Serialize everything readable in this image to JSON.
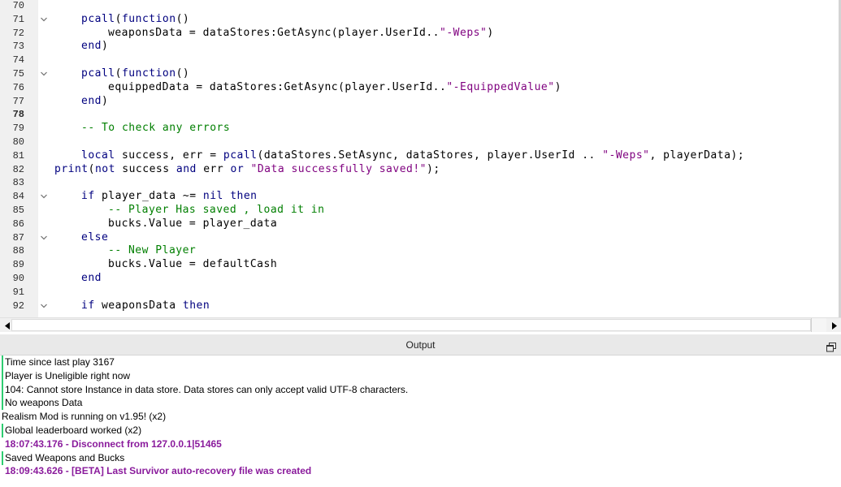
{
  "editor": {
    "lines": [
      {
        "n": "70",
        "fold": false,
        "indent": 0,
        "tokens": []
      },
      {
        "n": "71",
        "fold": true,
        "indent": 1,
        "tokens": [
          [
            "fn",
            "pcall"
          ],
          [
            "op",
            "("
          ],
          [
            "kw",
            "function"
          ],
          [
            "op",
            "()"
          ]
        ]
      },
      {
        "n": "72",
        "fold": false,
        "indent": 2,
        "tokens": [
          [
            "nm",
            "weaponsData = dataStores:GetAsync(player.UserId.."
          ],
          [
            "st",
            "\"-Weps\""
          ],
          [
            "op",
            ")"
          ]
        ]
      },
      {
        "n": "73",
        "fold": false,
        "indent": 1,
        "tokens": [
          [
            "kw",
            "end"
          ],
          [
            "op",
            ")"
          ]
        ]
      },
      {
        "n": "74",
        "fold": false,
        "indent": 0,
        "tokens": []
      },
      {
        "n": "75",
        "fold": true,
        "indent": 1,
        "tokens": [
          [
            "fn",
            "pcall"
          ],
          [
            "op",
            "("
          ],
          [
            "kw",
            "function"
          ],
          [
            "op",
            "()"
          ]
        ]
      },
      {
        "n": "76",
        "fold": false,
        "indent": 2,
        "tokens": [
          [
            "nm",
            "equippedData = dataStores:GetAsync(player.UserId.."
          ],
          [
            "st",
            "\"-EquippedValue\""
          ],
          [
            "op",
            ")"
          ]
        ]
      },
      {
        "n": "77",
        "fold": false,
        "indent": 1,
        "tokens": [
          [
            "kw",
            "end"
          ],
          [
            "op",
            ")"
          ]
        ]
      },
      {
        "n": "78",
        "fold": false,
        "indent": 0,
        "bold": true,
        "tokens": []
      },
      {
        "n": "79",
        "fold": false,
        "indent": 1,
        "tokens": [
          [
            "cm",
            "-- To check any errors"
          ]
        ]
      },
      {
        "n": "80",
        "fold": false,
        "indent": 0,
        "tokens": []
      },
      {
        "n": "81",
        "fold": false,
        "indent": 1,
        "tokens": [
          [
            "kw",
            "local"
          ],
          [
            "nm",
            " success, err = "
          ],
          [
            "fn",
            "pcall"
          ],
          [
            "nm",
            "(dataStores.SetAsync, dataStores, player.UserId .. "
          ],
          [
            "st",
            "\"-Weps\""
          ],
          [
            "nm",
            ", playerData);"
          ]
        ]
      },
      {
        "n": "82",
        "fold": false,
        "indent": 0,
        "tokens": [
          [
            "fn",
            "print"
          ],
          [
            "op",
            "("
          ],
          [
            "kw",
            "not"
          ],
          [
            "nm",
            " success "
          ],
          [
            "kw",
            "and"
          ],
          [
            "nm",
            " err "
          ],
          [
            "kw",
            "or"
          ],
          [
            "nm",
            " "
          ],
          [
            "st",
            "\"Data successfully saved!\""
          ],
          [
            "op",
            ");"
          ]
        ]
      },
      {
        "n": "83",
        "fold": false,
        "indent": 0,
        "tokens": []
      },
      {
        "n": "84",
        "fold": true,
        "indent": 1,
        "tokens": [
          [
            "kw",
            "if"
          ],
          [
            "nm",
            " player_data ~= "
          ],
          [
            "kw",
            "nil"
          ],
          [
            "nm",
            " "
          ],
          [
            "kw",
            "then"
          ]
        ]
      },
      {
        "n": "85",
        "fold": false,
        "indent": 2,
        "tokens": [
          [
            "cm",
            "-- Player Has saved , load it in"
          ]
        ]
      },
      {
        "n": "86",
        "fold": false,
        "indent": 2,
        "tokens": [
          [
            "nm",
            "bucks.Value = player_data"
          ]
        ]
      },
      {
        "n": "87",
        "fold": true,
        "indent": 1,
        "tokens": [
          [
            "kw",
            "else"
          ]
        ]
      },
      {
        "n": "88",
        "fold": false,
        "indent": 2,
        "tokens": [
          [
            "cm",
            "-- New Player"
          ]
        ]
      },
      {
        "n": "89",
        "fold": false,
        "indent": 2,
        "tokens": [
          [
            "nm",
            "bucks.Value = defaultCash"
          ]
        ]
      },
      {
        "n": "90",
        "fold": false,
        "indent": 1,
        "tokens": [
          [
            "kw",
            "end"
          ]
        ]
      },
      {
        "n": "91",
        "fold": false,
        "indent": 0,
        "tokens": []
      },
      {
        "n": "92",
        "fold": true,
        "indent": 1,
        "tokens": [
          [
            "kw",
            "if"
          ],
          [
            "nm",
            " weaponsData "
          ],
          [
            "kw",
            "then"
          ]
        ]
      }
    ]
  },
  "output": {
    "title": "Output",
    "restore_icon": "restore-window-icon",
    "messages": [
      {
        "text": "Time since last play 3167",
        "style": "bar"
      },
      {
        "text": "Player is Uneligible right now",
        "style": "bar"
      },
      {
        "text": "104: Cannot store Instance in data store. Data stores can only accept valid UTF-8 characters.",
        "style": "bar"
      },
      {
        "text": "No weapons Data",
        "style": "bar"
      },
      {
        "text": "Realism Mod is running on v1.95! (x2)",
        "style": "nobar"
      },
      {
        "text": "Global leaderboard worked (x2)",
        "style": "bar"
      },
      {
        "text": "18:07:43.176 - Disconnect from 127.0.0.1|51465",
        "style": "purple"
      },
      {
        "text": "Saved Weapons and Bucks",
        "style": "bar"
      },
      {
        "text": "18:09:43.626 - [BETA] Last Survivor auto-recovery file was created",
        "style": "purple"
      }
    ]
  },
  "colors": {
    "keyword": "#00007f",
    "string": "#7f007f",
    "comment": "#007f00",
    "output_bar": "#2ecc71",
    "output_warning": "#8a1b9c"
  }
}
